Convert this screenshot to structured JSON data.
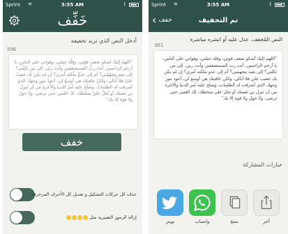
{
  "status_bar": {
    "carrier": "Sprint",
    "time": "3:55 AM"
  },
  "left": {
    "logo": "خَفِّف",
    "instruction": "أدخل النص الذي تريد تخفيفه",
    "char_count": "596",
    "input_text": "\"اللهمّ إليكَ أشكو ضَعفَ قوّتِي، وقِلّةَ حِيلتي، وهَواني على الناسِ، يا أرحمَ الراحمينَ، أنتَ ربُّ المُستضعَفينَ وأنتَ ربّي، إلى مَن تَكِلُني؟ إلى بعيدٍ يتجهّمُني؟ أم إلى عدوٍّ ملّكتَه أمري؟ إن لم يكن بكَ غضبٌ عليّ فلا أُبالي، ولكنّ عافيتَك هي أوسعُ لي، أعوذُ بنورِ وجهكَ الذي أشرقت له الظلماتُ، وصَلُحَ عليه أمرُ الدنيا والآخرةِ من أن تُنزِلَ بي غضبَك أو تُحِلَّ عليّ سَخَطَك، لكَ العُتبى حتى ترضى، ولا حولَ ولا قوّةَ إلا بك\"",
    "button_label": "خفف",
    "toggle1_label": "حذف كل حركات التشكيل و تعديل كل الأحرف المزخرفة",
    "toggle2_label": "إزالة الرموز التعبيرية مثل",
    "toggle1_on": true,
    "toggle2_on": true
  },
  "right": {
    "back_label": "خفف",
    "title": "تم التخفيف",
    "instruction": "النص المُخفف. عدل عليه أو انشره مباشرة",
    "char_count": "361",
    "output_text": "\"اللهم إليك أشكو ضعف قوتي، وقلة حيلتي، وهواني على الناس، يا أرحم الراحمين، أنت رب المستضعفين وأنت ربي، إلى من تكلني؟ إلى بعيد يتجهمني؟ أم إلى عدو ملكته أمري؟ إن لم يكن بك غضب علي فلا أبالي، ولكن عافيتك هي أوسع لي، أعوذ بنور وجهك الذي أشرقت له الظلمات، وصلح عليه أمر الدنيا والآخرة من أن تنزل بي غضبك أو تحل علي سخطك، لك العتبى حتى ترضى، ولا حول ولا قوة إلا بك\"",
    "share_title": "خيارات المشاركة",
    "share_options": [
      {
        "label": "تويتر",
        "icon": "twitter-icon",
        "color": "#4aa9e2"
      },
      {
        "label": "واتساب",
        "icon": "whatsapp-icon",
        "color": "#3ec24f"
      },
      {
        "label": "نسخ",
        "icon": "copy-icon"
      },
      {
        "label": "آخر",
        "icon": "share-icon"
      }
    ]
  },
  "colors": {
    "nav": "#2e5148",
    "button": "#466b5e",
    "toggle": "#48695d"
  }
}
